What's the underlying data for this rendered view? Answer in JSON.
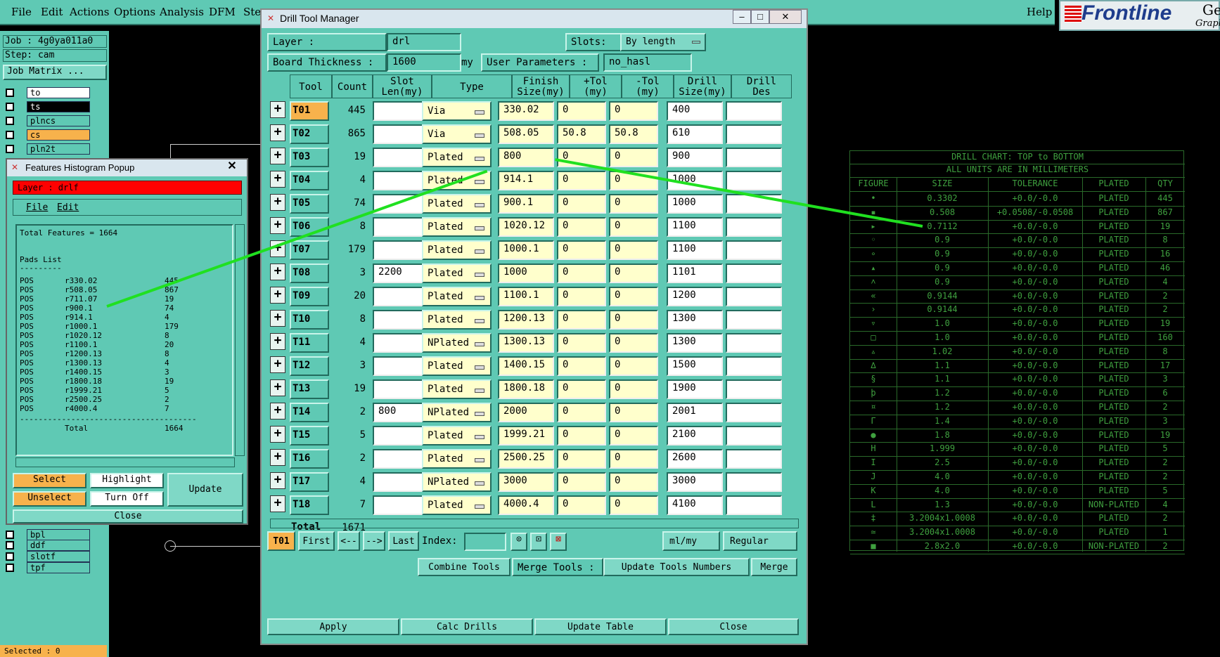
{
  "menubar": {
    "items": [
      "File",
      "Edit",
      "Actions",
      "Options",
      "Analysis",
      "DFM",
      "Ste"
    ],
    "help": "Help"
  },
  "logo": {
    "brand": "Frontline",
    "suffix": "Genes",
    "sub": "Graph"
  },
  "leftpanel": {
    "job": "Job : 4g0ya011a0",
    "step": "Step: cam",
    "job_matrix": "Job Matrix ...",
    "layers_top": [
      "to",
      "ts",
      "plncs",
      "cs",
      "pln2t"
    ],
    "layers_bottom": [
      "bpl",
      "ddf",
      "slotf",
      "tpf"
    ],
    "selected": "Selected : 0"
  },
  "histogram": {
    "title": "Features Histogram Popup",
    "layer_label": "Layer :  drlf",
    "menu": [
      "File",
      "Edit"
    ],
    "total_features": "Total Features = 1664",
    "pads_header": "Pads List",
    "underline": "---------",
    "rows": [
      [
        "POS",
        "r330.02",
        "445"
      ],
      [
        "POS",
        "r508.05",
        "867"
      ],
      [
        "POS",
        "r711.07",
        "19"
      ],
      [
        "POS",
        "r900.1",
        "74"
      ],
      [
        "POS",
        "r914.1",
        "4"
      ],
      [
        "POS",
        "r1000.1",
        "179"
      ],
      [
        "POS",
        "r1020.12",
        "8"
      ],
      [
        "POS",
        "r1100.1",
        "20"
      ],
      [
        "POS",
        "r1200.13",
        "8"
      ],
      [
        "POS",
        "r1300.13",
        "4"
      ],
      [
        "POS",
        "r1400.15",
        "3"
      ],
      [
        "POS",
        "r1800.18",
        "19"
      ],
      [
        "POS",
        "r1999.21",
        "5"
      ],
      [
        "POS",
        "r2500.25",
        "2"
      ],
      [
        "POS",
        "r4000.4",
        "7"
      ]
    ],
    "dashes": "--------------------------------------",
    "total_label": "Total",
    "total_value": "1664",
    "buttons": {
      "select": "Select",
      "highlight": "Highlight",
      "update": "Update",
      "unselect": "Unselect",
      "turnoff": "Turn Off",
      "close": "Close"
    }
  },
  "dtm": {
    "title": "Drill Tool Manager",
    "layer_label": "Layer          :",
    "layer_value": "drl",
    "slots_label": "Slots:",
    "slots_value": "By length",
    "board_label": "Board Thickness :",
    "board_value": "1600",
    "board_unit": "my",
    "userparams_label": "User Parameters  :",
    "userparams_value": "no_hasl",
    "headers": [
      "Tool",
      "Count",
      "Slot\nLen(my)",
      "Type",
      "Finish\nSize(my)",
      "+Tol\n(my)",
      "-Tol\n(my)",
      "Drill\nSize(my)",
      "Drill\nDes"
    ],
    "tools": [
      {
        "tool": "T01",
        "count": "445",
        "slot": "",
        "type": "Via",
        "finish": "330.02",
        "ptol": "0",
        "mtol": "0",
        "drill": "400"
      },
      {
        "tool": "T02",
        "count": "865",
        "slot": "",
        "type": "Via",
        "finish": "508.05",
        "ptol": "50.8",
        "mtol": "50.8",
        "drill": "610"
      },
      {
        "tool": "T03",
        "count": "19",
        "slot": "",
        "type": "Plated",
        "finish": "800",
        "ptol": "0",
        "mtol": "0",
        "drill": "900"
      },
      {
        "tool": "T04",
        "count": "4",
        "slot": "",
        "type": "Plated",
        "finish": "914.1",
        "ptol": "0",
        "mtol": "0",
        "drill": "1000"
      },
      {
        "tool": "T05",
        "count": "74",
        "slot": "",
        "type": "Plated",
        "finish": "900.1",
        "ptol": "0",
        "mtol": "0",
        "drill": "1000"
      },
      {
        "tool": "T06",
        "count": "8",
        "slot": "",
        "type": "Plated",
        "finish": "1020.12",
        "ptol": "0",
        "mtol": "0",
        "drill": "1100"
      },
      {
        "tool": "T07",
        "count": "179",
        "slot": "",
        "type": "Plated",
        "finish": "1000.1",
        "ptol": "0",
        "mtol": "0",
        "drill": "1100"
      },
      {
        "tool": "T08",
        "count": "3",
        "slot": "2200",
        "type": "Plated",
        "finish": "1000",
        "ptol": "0",
        "mtol": "0",
        "drill": "1101"
      },
      {
        "tool": "T09",
        "count": "20",
        "slot": "",
        "type": "Plated",
        "finish": "1100.1",
        "ptol": "0",
        "mtol": "0",
        "drill": "1200"
      },
      {
        "tool": "T10",
        "count": "8",
        "slot": "",
        "type": "Plated",
        "finish": "1200.13",
        "ptol": "0",
        "mtol": "0",
        "drill": "1300"
      },
      {
        "tool": "T11",
        "count": "4",
        "slot": "",
        "type": "NPlated",
        "finish": "1300.13",
        "ptol": "0",
        "mtol": "0",
        "drill": "1300"
      },
      {
        "tool": "T12",
        "count": "3",
        "slot": "",
        "type": "Plated",
        "finish": "1400.15",
        "ptol": "0",
        "mtol": "0",
        "drill": "1500"
      },
      {
        "tool": "T13",
        "count": "19",
        "slot": "",
        "type": "Plated",
        "finish": "1800.18",
        "ptol": "0",
        "mtol": "0",
        "drill": "1900"
      },
      {
        "tool": "T14",
        "count": "2",
        "slot": "800",
        "type": "NPlated",
        "finish": "2000",
        "ptol": "0",
        "mtol": "0",
        "drill": "2001"
      },
      {
        "tool": "T15",
        "count": "5",
        "slot": "",
        "type": "Plated",
        "finish": "1999.21",
        "ptol": "0",
        "mtol": "0",
        "drill": "2100"
      },
      {
        "tool": "T16",
        "count": "2",
        "slot": "",
        "type": "Plated",
        "finish": "2500.25",
        "ptol": "0",
        "mtol": "0",
        "drill": "2600"
      },
      {
        "tool": "T17",
        "count": "4",
        "slot": "",
        "type": "NPlated",
        "finish": "3000",
        "ptol": "0",
        "mtol": "0",
        "drill": "3000"
      },
      {
        "tool": "T18",
        "count": "7",
        "slot": "",
        "type": "Plated",
        "finish": "4000.4",
        "ptol": "0",
        "mtol": "0",
        "drill": "4100"
      }
    ],
    "total_label": "Total",
    "total_value": "1671",
    "nav": {
      "current": "T01",
      "first": "First",
      "prev": "<--",
      "next": "-->",
      "last": "Last",
      "index": "Index:",
      "units": "ml/my",
      "mode": "Regular"
    },
    "actions": {
      "combine": "Combine Tools",
      "merge_tools": "Merge Tools  :",
      "update_numbers": "Update Tools Numbers",
      "merge": "Merge",
      "apply": "Apply",
      "calc": "Calc Drills",
      "update_table": "Update Table",
      "close": "Close"
    }
  },
  "chart": {
    "title1": "DRILL CHART: TOP to BOTTOM",
    "title2": "ALL UNITS ARE IN MILLIMETERS",
    "headers": [
      "FIGURE",
      "SIZE",
      "TOLERANCE",
      "PLATED",
      "QTY"
    ],
    "rows": [
      [
        "•",
        "0.3302",
        "+0.0/-0.0",
        "PLATED",
        "445"
      ],
      [
        "▪",
        "0.508",
        "+0.0508/-0.0508",
        "PLATED",
        "867"
      ],
      [
        "▸",
        "0.7112",
        "+0.0/-0.0",
        "PLATED",
        "19"
      ],
      [
        "◦",
        "0.9",
        "+0.0/-0.0",
        "PLATED",
        "8"
      ],
      [
        "∘",
        "0.9",
        "+0.0/-0.0",
        "PLATED",
        "16"
      ],
      [
        "▴",
        "0.9",
        "+0.0/-0.0",
        "PLATED",
        "46"
      ],
      [
        "˄",
        "0.9",
        "+0.0/-0.0",
        "PLATED",
        "4"
      ],
      [
        "«",
        "0.9144",
        "+0.0/-0.0",
        "PLATED",
        "2"
      ],
      [
        "›",
        "0.9144",
        "+0.0/-0.0",
        "PLATED",
        "2"
      ],
      [
        "▿",
        "1.0",
        "+0.0/-0.0",
        "PLATED",
        "19"
      ],
      [
        "□",
        "1.0",
        "+0.0/-0.0",
        "PLATED",
        "160"
      ],
      [
        "▵",
        "1.02",
        "+0.0/-0.0",
        "PLATED",
        "8"
      ],
      [
        "∆",
        "1.1",
        "+0.0/-0.0",
        "PLATED",
        "17"
      ],
      [
        "§",
        "1.1",
        "+0.0/-0.0",
        "PLATED",
        "3"
      ],
      [
        "þ",
        "1.2",
        "+0.0/-0.0",
        "PLATED",
        "6"
      ],
      [
        "¤",
        "1.2",
        "+0.0/-0.0",
        "PLATED",
        "2"
      ],
      [
        "Γ",
        "1.4",
        "+0.0/-0.0",
        "PLATED",
        "3"
      ],
      [
        "●",
        "1.8",
        "+0.0/-0.0",
        "PLATED",
        "19"
      ],
      [
        "H",
        "1.999",
        "+0.0/-0.0",
        "PLATED",
        "5"
      ],
      [
        "I",
        "2.5",
        "+0.0/-0.0",
        "PLATED",
        "2"
      ],
      [
        "J",
        "4.0",
        "+0.0/-0.0",
        "PLATED",
        "2"
      ],
      [
        "K",
        "4.0",
        "+0.0/-0.0",
        "PLATED",
        "5"
      ],
      [
        "L",
        "1.3",
        "+0.0/-0.0",
        "NON-PLATED",
        "4"
      ],
      [
        "‡",
        "3.2004x1.0008",
        "+0.0/-0.0",
        "PLATED",
        "2"
      ],
      [
        "≃",
        "3.2004x1.0008",
        "+0.0/-0.0",
        "PLATED",
        "1"
      ],
      [
        "■",
        "2.8x2.0",
        "+0.0/-0.0",
        "NON-PLATED",
        "2"
      ]
    ]
  },
  "colors": {
    "panel": "#5fc9b4",
    "highlight": "#f7b24c",
    "arrow": "#20e020",
    "chart_text": "#3fa03f"
  }
}
